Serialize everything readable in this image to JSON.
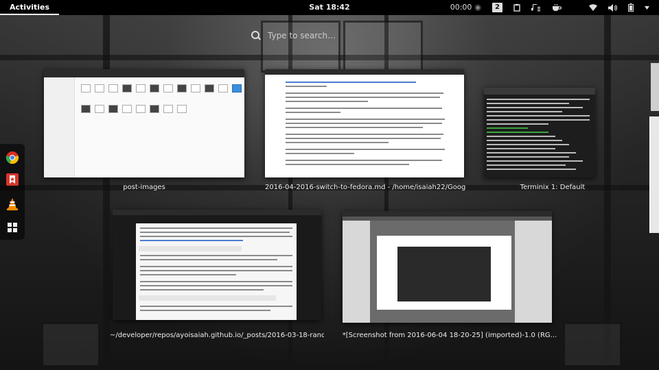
{
  "topbar": {
    "activities_label": "Activities",
    "clock": "Sat 18:42",
    "timer": "00:00",
    "workspace_number": "2"
  },
  "search": {
    "placeholder": "Type to search…"
  },
  "windows": {
    "files_caption": "post-images",
    "editor_caption": "2016-04-2016-switch-to-fedora.md - /home/isaiah22/Goog...",
    "terminal_caption": "Terminix 1: Default",
    "editor2_caption": "~/developer/repos/ayoisaiah.github.io/_posts/2016-03-18-rand...",
    "gimp_caption": "*[Screenshot from 2016-06-04 18-20-25] (imported)-1.0 (RG..."
  },
  "dash": {
    "apps": [
      "chrome-icon",
      "bookmark-app-icon",
      "vlc-icon",
      "app-grid-icon"
    ]
  },
  "colors": {
    "topbar_bg": "#000000",
    "selection": "#3b8ede",
    "terminal_green": "#3da53d"
  }
}
